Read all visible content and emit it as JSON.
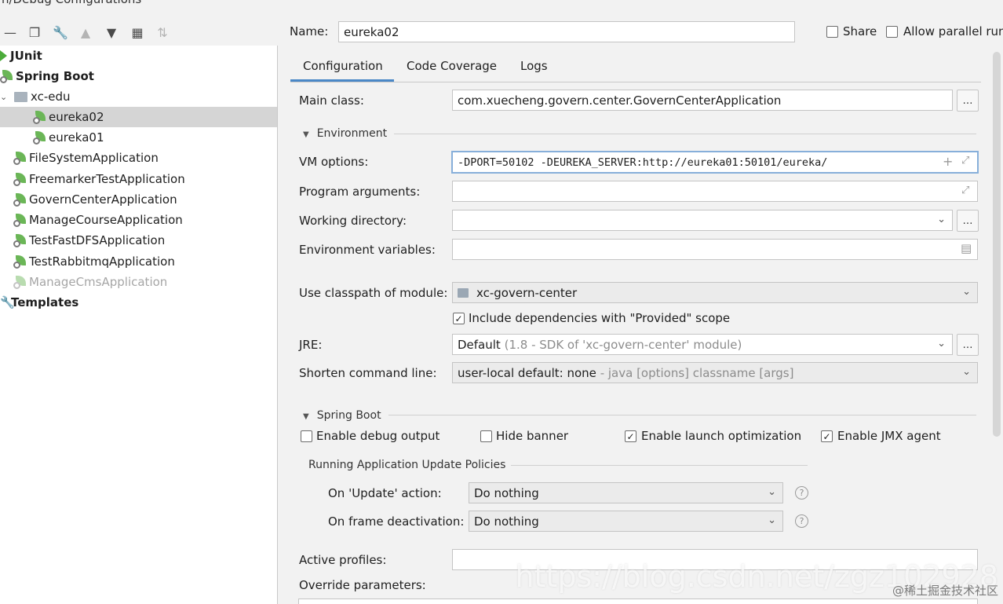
{
  "window": {
    "title": "n/Debug Configurations"
  },
  "toolbar": {
    "icons": [
      "minus-icon",
      "copy-icon",
      "wrench-icon",
      "arrow-up-icon",
      "arrow-down-icon",
      "folder-add-icon",
      "sort-icon"
    ]
  },
  "tree": {
    "junit": "JUnit",
    "spring_boot": "Spring Boot",
    "folder": "xc-edu",
    "item_eureka02": "eureka02",
    "item_eureka01": "eureka01",
    "app_filesystem": "FileSystemApplication",
    "app_freemarker": "FreemarkerTestApplication",
    "app_govern": "GovernCenterApplication",
    "app_managecourse": "ManageCourseApplication",
    "app_testfastdfs": "TestFastDFSApplication",
    "app_testrabbitmq": "TestRabbitmqApplication",
    "app_managecms": "ManageCmsApplication",
    "templates": "Templates"
  },
  "header": {
    "name_label": "Name:",
    "name_value": "eureka02",
    "share_label": "Share",
    "parallel_label": "Allow parallel run"
  },
  "tabs": {
    "configuration": "Configuration",
    "code_coverage": "Code Coverage",
    "logs": "Logs"
  },
  "form": {
    "main_class_label": "Main class:",
    "main_class_value": "com.xuecheng.govern.center.GovernCenterApplication",
    "environment_section": "Environment",
    "vm_options_label": "VM options:",
    "vm_options_value": "-DPORT=50102 -DEUREKA_SERVER:http://eureka01:50101/eureka/",
    "program_args_label": "Program arguments:",
    "working_dir_label": "Working directory:",
    "env_vars_label": "Environment variables:",
    "classpath_label": "Use classpath of module:",
    "classpath_value": "xc-govern-center",
    "include_deps_label": "Include dependencies with \"Provided\" scope",
    "jre_label": "JRE:",
    "jre_value": "Default",
    "jre_hint": "(1.8 - SDK of 'xc-govern-center' module)",
    "shorten_label": "Shorten command line:",
    "shorten_value": "user-local default: none",
    "shorten_hint": " - java [options] classname [args]",
    "spring_boot_section": "Spring Boot",
    "debug_output_label": "Enable debug output",
    "hide_banner_label": "Hide banner",
    "launch_opt_label": "Enable launch optimization",
    "jmx_label": "Enable JMX agent",
    "update_policies_section": "Running Application Update Policies",
    "on_update_label": "On 'Update' action:",
    "on_update_value": "Do nothing",
    "on_frame_label": "On frame deactivation:",
    "on_frame_value": "Do nothing",
    "active_profiles_label": "Active profiles:",
    "override_params_label": "Override parameters:"
  },
  "checkbox_state": {
    "share": false,
    "parallel": false,
    "include_deps": true,
    "debug_output": false,
    "hide_banner": false,
    "launch_opt": true,
    "jmx": true
  },
  "watermark": {
    "main": "https://blog.csdn.net/zgz102928",
    "sub": "@稀土掘金技术社区"
  },
  "colors": {
    "accent": "#4a88c7",
    "selection": "#d5d5d5",
    "spring_green": "#6bb657"
  }
}
